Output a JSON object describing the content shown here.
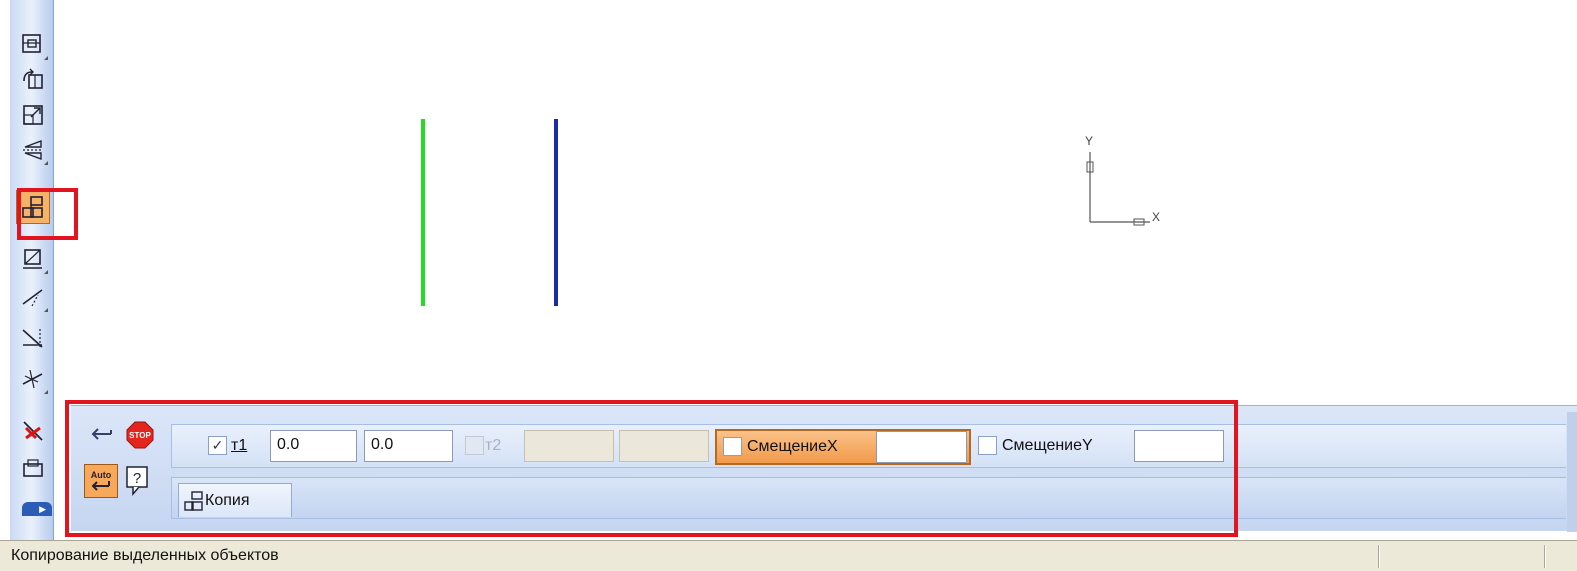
{
  "toolbar": {
    "tools": [
      {
        "icon": "select-window-icon"
      },
      {
        "icon": "rotate-icon"
      },
      {
        "icon": "scale-icon"
      },
      {
        "icon": "symmetry-icon"
      },
      {
        "icon": "copy-icon",
        "active": true
      },
      {
        "icon": "deform-icon"
      },
      {
        "icon": "trim-icon"
      },
      {
        "icon": "trim-two-points-icon"
      },
      {
        "icon": "break-icon"
      },
      {
        "icon": "delete-icon"
      },
      {
        "icon": "rectangle-copy-icon"
      }
    ]
  },
  "axes": {
    "y_label": "Y",
    "x_label": "X"
  },
  "panel": {
    "t1_label": "т1",
    "t1_x": "0.0",
    "t1_y": "0.0",
    "t2_label": "т2",
    "offset_x_label": "СмещениеX",
    "offset_x_value": "",
    "offset_y_label": "СмещениеY",
    "offset_y_value": "",
    "tab_label": "Копия",
    "auto_label": "Auto"
  },
  "status": {
    "text": "Копирование выделенных объектов"
  },
  "colors": {
    "highlight": "#e2141f",
    "green_line": "#22dd22",
    "blue_line": "#1a2ba8",
    "active_tool": "#f7b26a"
  }
}
